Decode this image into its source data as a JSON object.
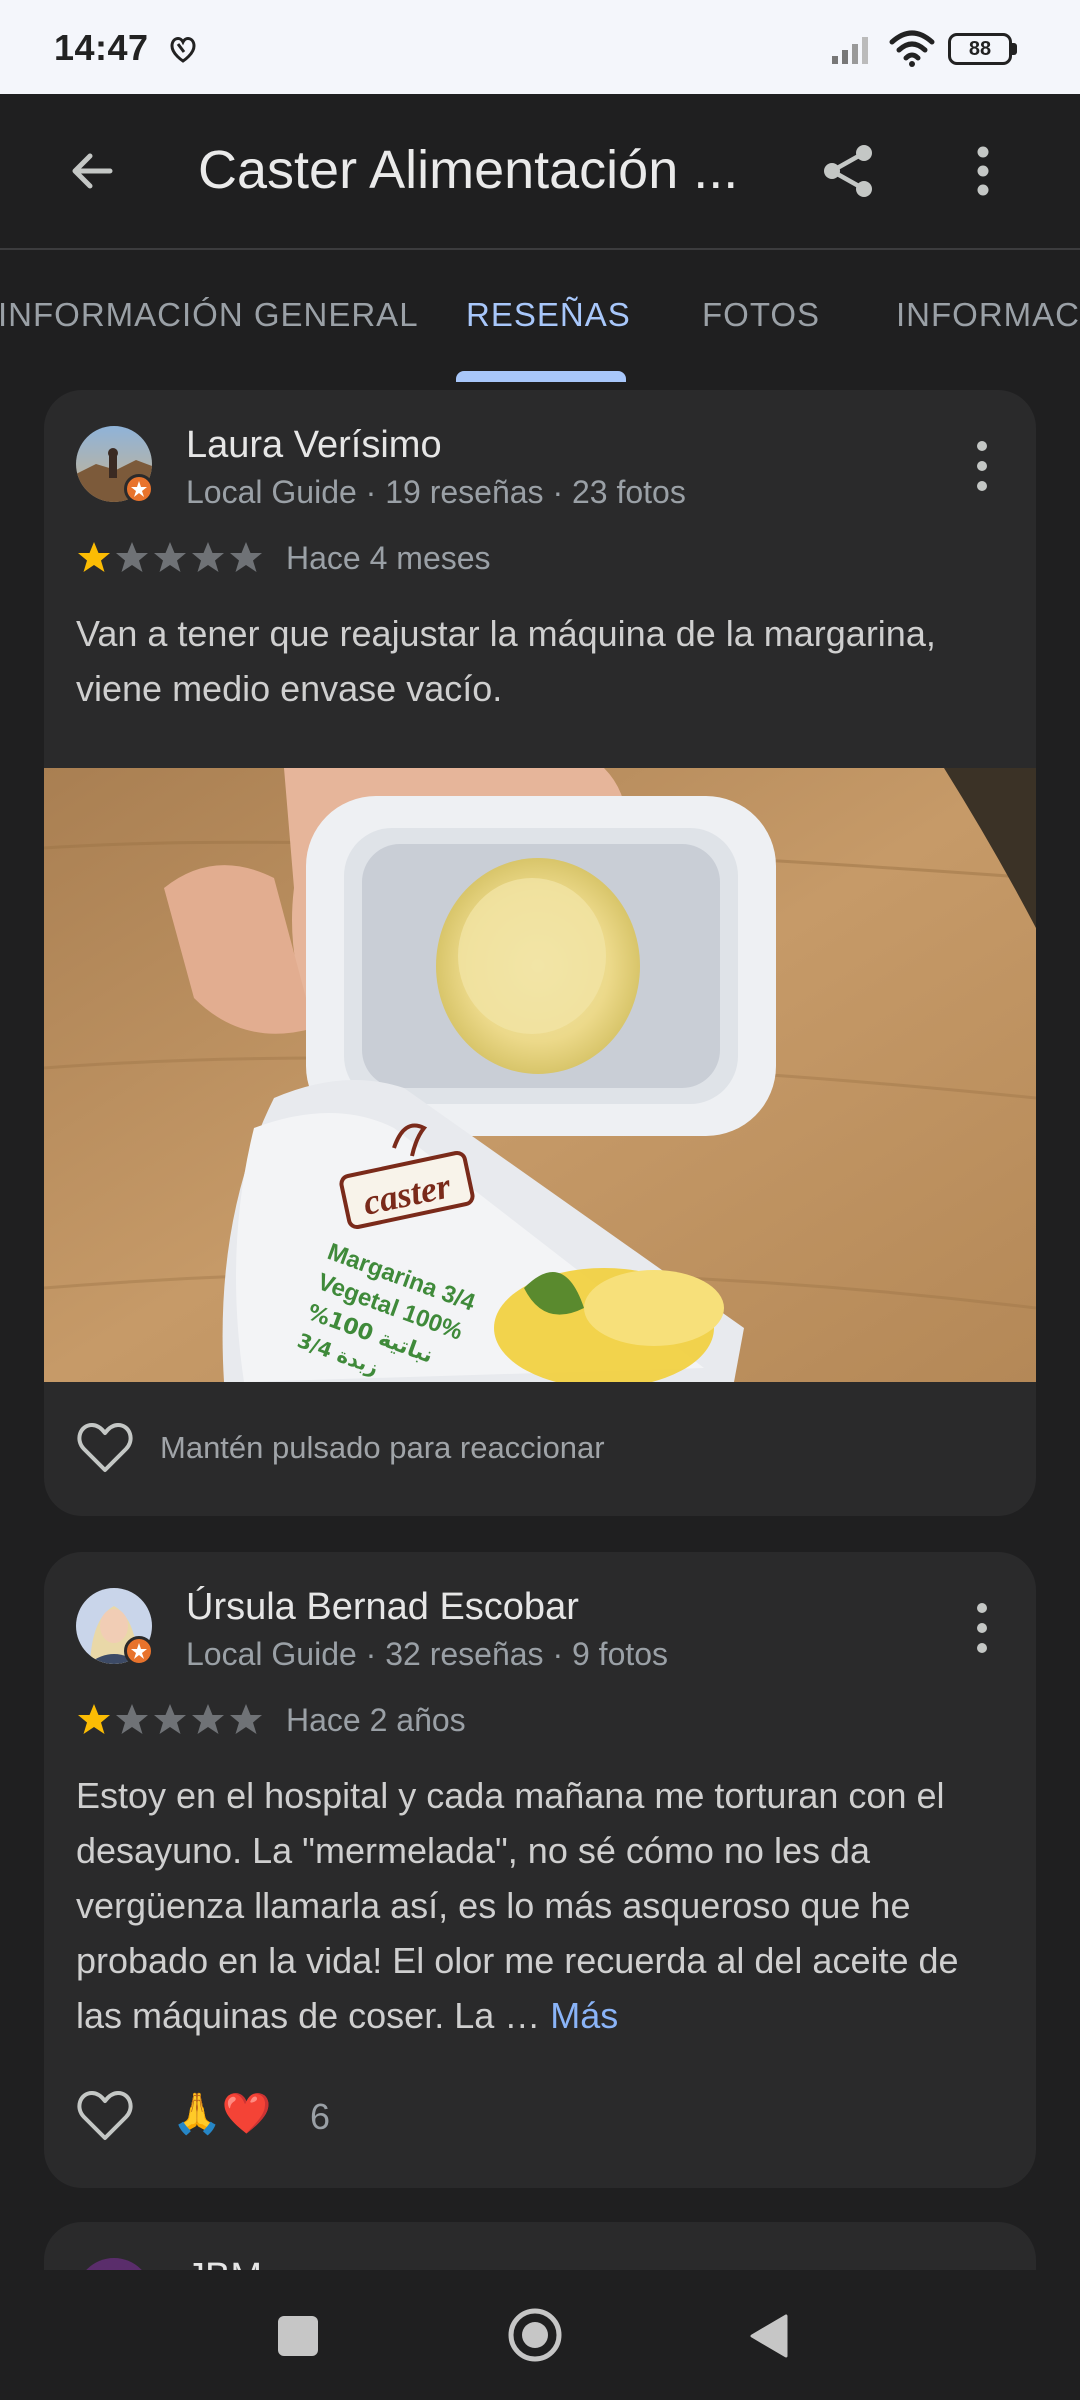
{
  "status_bar": {
    "time": "14:47",
    "battery": "88",
    "icons": [
      "notification-icon",
      "signal-icon",
      "wifi-icon",
      "battery-icon"
    ]
  },
  "app_bar": {
    "title": "Caster Alimentación ...",
    "back_icon": "arrow-back-icon",
    "share_icon": "share-icon",
    "more_icon": "more-vert-icon"
  },
  "tabs": [
    {
      "label": "INFORMACIÓN GENERAL",
      "active": false
    },
    {
      "label": "RESEÑAS",
      "active": true
    },
    {
      "label": "FOTOS",
      "active": false
    },
    {
      "label": "INFORMACIÓN",
      "active": false
    }
  ],
  "reviews": [
    {
      "name": "Laura Verísimo",
      "meta": "Local Guide · 19 reseñas · 23 fotos",
      "rating": 1,
      "rating_max": 5,
      "when": "Hace 4 meses",
      "text": "Van a tener que reajustar la máquina de la margarina, viene medio envase vacío.",
      "photo": {
        "brand": "caster",
        "line1": "Margarina 3/4",
        "line2": "Vegetal 100%",
        "line3": "%100 نباتية",
        "line4": "3/4 زبدة"
      },
      "reaction_hint": "Mantén pulsado para reaccionar"
    },
    {
      "name": "Úrsula Bernad Escobar",
      "meta": "Local Guide · 32 reseñas · 9 fotos",
      "rating": 1,
      "rating_max": 5,
      "when": "Hace 2 años",
      "text": "Estoy en el hospital y cada mañana me torturan con el desayuno. La \"mermelada\", no sé cómo no les da vergüenza llamarla así, es lo más asqueroso que he probado en la vida! El olor me recuerda al del aceite de las máquinas de coser. La …",
      "more_label": "Más",
      "reactions_emoji": "🙏❤️",
      "reactions_count": "6"
    },
    {
      "name": "JBM"
    }
  ],
  "colors": {
    "background": "#1f1f20",
    "card": "#2a2a2b",
    "accent": "#a8c7fa",
    "star_filled": "#fbbc04",
    "star_empty": "#6f7276",
    "local_guide_badge": "#e8732c"
  },
  "nav_bar": {
    "icons": [
      "recents-icon",
      "home-icon",
      "back-icon"
    ]
  }
}
